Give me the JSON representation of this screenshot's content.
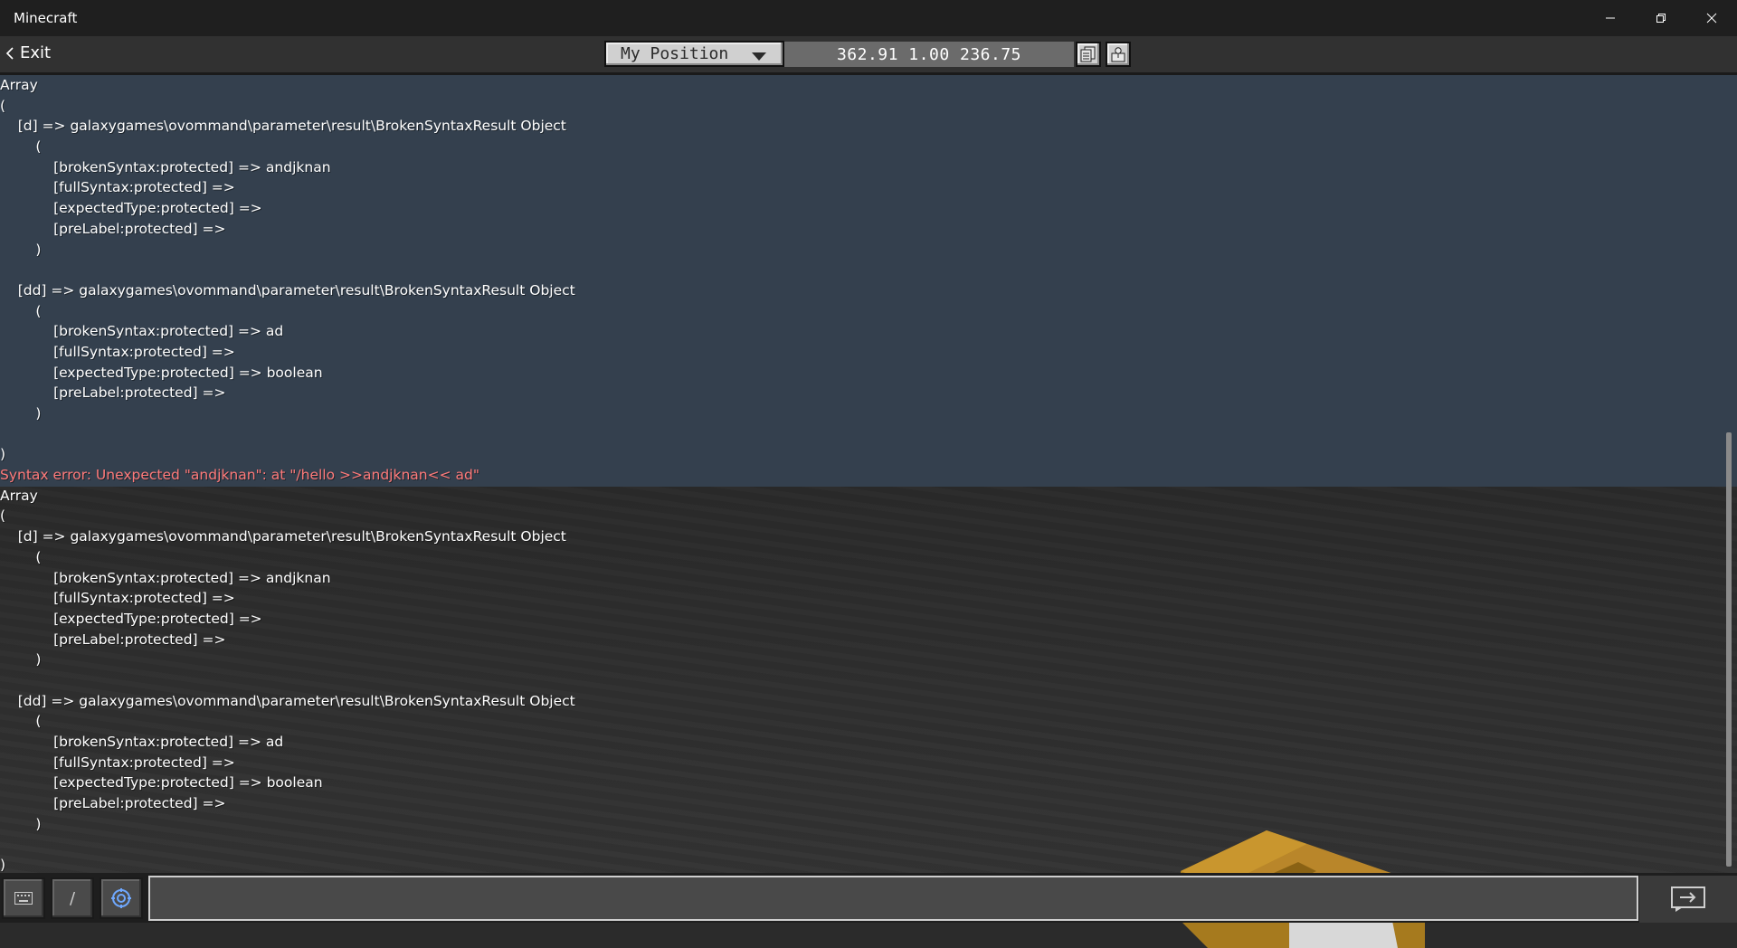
{
  "window": {
    "title": "Minecraft",
    "minimize_glyph": "—",
    "restore_glyph": "❐",
    "close_glyph": "✕"
  },
  "toolbar": {
    "exit_label": "Exit",
    "position_dropdown": "My Position",
    "coordinates": "362.91 1.00 236.75",
    "copy_icon": "copy-icon",
    "teleport_icon": "teleport-icon"
  },
  "chat": {
    "lines": [
      {
        "text": "Array",
        "type": "normal"
      },
      {
        "text": "(",
        "type": "normal"
      },
      {
        "text": "    [d] => galaxygames\\ovommand\\parameter\\result\\BrokenSyntaxResult Object",
        "type": "normal"
      },
      {
        "text": "        (",
        "type": "normal"
      },
      {
        "text": "            [brokenSyntax:protected] => andjknan",
        "type": "normal"
      },
      {
        "text": "            [fullSyntax:protected] =>",
        "type": "normal"
      },
      {
        "text": "            [expectedType:protected] =>",
        "type": "normal"
      },
      {
        "text": "            [preLabel:protected] =>",
        "type": "normal"
      },
      {
        "text": "        )",
        "type": "normal"
      },
      {
        "text": "",
        "type": "normal"
      },
      {
        "text": "    [dd] => galaxygames\\ovommand\\parameter\\result\\BrokenSyntaxResult Object",
        "type": "normal"
      },
      {
        "text": "        (",
        "type": "normal"
      },
      {
        "text": "            [brokenSyntax:protected] => ad",
        "type": "normal"
      },
      {
        "text": "            [fullSyntax:protected] =>",
        "type": "normal"
      },
      {
        "text": "            [expectedType:protected] => boolean",
        "type": "normal"
      },
      {
        "text": "            [preLabel:protected] =>",
        "type": "normal"
      },
      {
        "text": "        )",
        "type": "normal"
      },
      {
        "text": "",
        "type": "normal"
      },
      {
        "text": ")",
        "type": "normal"
      },
      {
        "text": "Syntax error: Unexpected \"andjknan\": at \"/hello >>andjknan<< ad\"",
        "type": "error"
      },
      {
        "text": "Array",
        "type": "normal"
      },
      {
        "text": "(",
        "type": "normal"
      },
      {
        "text": "    [d] => galaxygames\\ovommand\\parameter\\result\\BrokenSyntaxResult Object",
        "type": "normal"
      },
      {
        "text": "        (",
        "type": "normal"
      },
      {
        "text": "            [brokenSyntax:protected] => andjknan",
        "type": "normal"
      },
      {
        "text": "            [fullSyntax:protected] =>",
        "type": "normal"
      },
      {
        "text": "            [expectedType:protected] =>",
        "type": "normal"
      },
      {
        "text": "            [preLabel:protected] =>",
        "type": "normal"
      },
      {
        "text": "        )",
        "type": "normal"
      },
      {
        "text": "",
        "type": "normal"
      },
      {
        "text": "    [dd] => galaxygames\\ovommand\\parameter\\result\\BrokenSyntaxResult Object",
        "type": "normal"
      },
      {
        "text": "        (",
        "type": "normal"
      },
      {
        "text": "            [brokenSyntax:protected] => ad",
        "type": "normal"
      },
      {
        "text": "            [fullSyntax:protected] =>",
        "type": "normal"
      },
      {
        "text": "            [expectedType:protected] => boolean",
        "type": "normal"
      },
      {
        "text": "            [preLabel:protected] =>",
        "type": "normal"
      },
      {
        "text": "        )",
        "type": "normal"
      },
      {
        "text": "",
        "type": "normal"
      },
      {
        "text": ")",
        "type": "normal"
      }
    ]
  },
  "bottom": {
    "keyboard_icon": "keyboard-icon",
    "slash_label": "/",
    "settings_icon": "settings-icon",
    "input_value": "",
    "send_icon": "send-icon"
  },
  "colors": {
    "error_text": "#ff7a7a",
    "chat_highlight": "#34404e"
  }
}
